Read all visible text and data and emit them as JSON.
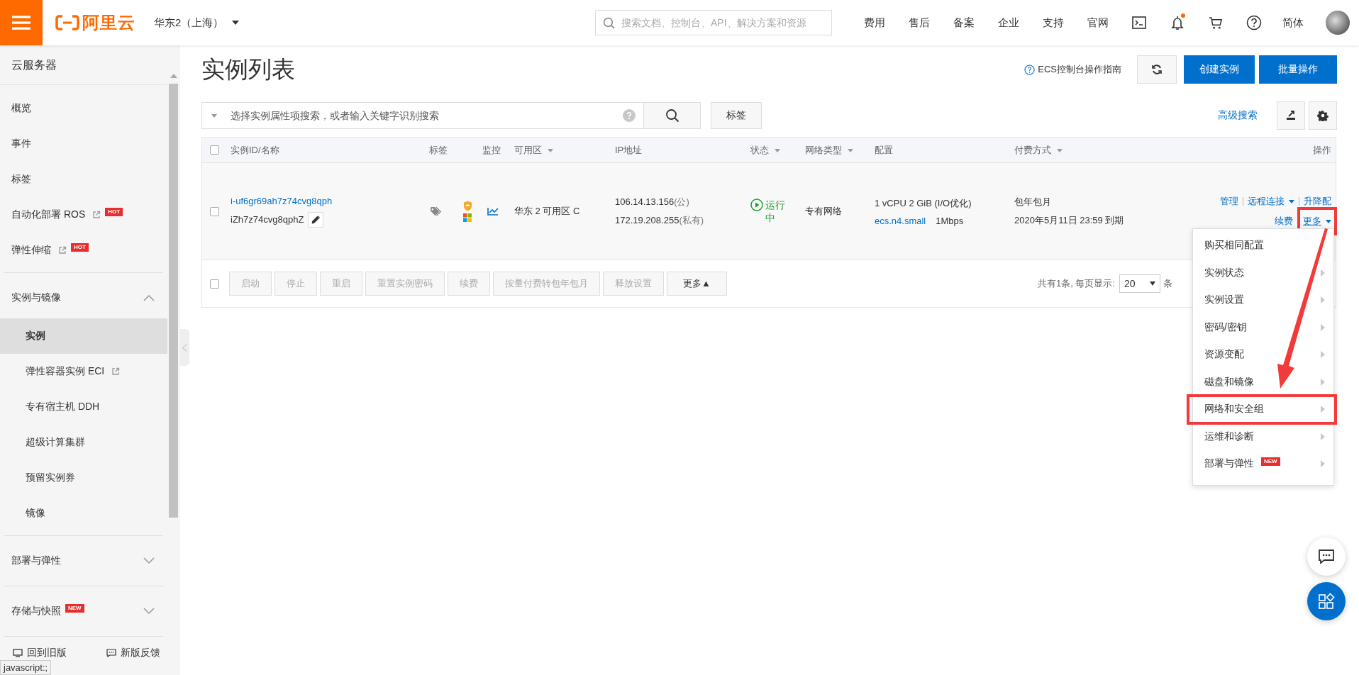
{
  "topbar": {
    "brand": "阿里云",
    "region": "华东2（上海）",
    "search": {
      "placeholder": "搜索文档、控制台、API、解决方案和资源"
    },
    "nav": [
      "费用",
      "售后",
      "备案",
      "企业",
      "支持",
      "官网"
    ],
    "notification_dot": true,
    "language": "简体"
  },
  "sidebar": {
    "title": "云服务器",
    "items": [
      {
        "label": "概览",
        "external": false
      },
      {
        "label": "事件",
        "external": false
      },
      {
        "label": "标签",
        "external": false
      },
      {
        "label": "自动化部署 ROS",
        "external": true,
        "badge": "HOT"
      },
      {
        "label": "弹性伸缩",
        "external": true,
        "badge": "HOT"
      }
    ],
    "groups": [
      {
        "label": "实例与镜像",
        "expanded": true,
        "children": [
          {
            "label": "实例",
            "selected": true,
            "external": false
          },
          {
            "label": "弹性容器实例 ECI",
            "selected": false,
            "external": true
          },
          {
            "label": "专有宿主机 DDH",
            "selected": false,
            "external": false
          },
          {
            "label": "超级计算集群",
            "selected": false,
            "external": false
          },
          {
            "label": "预留实例券",
            "selected": false,
            "external": false
          },
          {
            "label": "镜像",
            "selected": false,
            "external": false
          }
        ]
      },
      {
        "label": "部署与弹性",
        "expanded": false
      },
      {
        "label": "存储与快照",
        "expanded": false,
        "badge": "NEW"
      }
    ],
    "footer": [
      "回到旧版",
      "新版反馈"
    ]
  },
  "page": {
    "title": "实例列表",
    "guide_link": "ECS控制台操作指南",
    "buttons": [
      "创建实例",
      "批量操作"
    ]
  },
  "search": {
    "placeholder": "选择实例属性项搜索，或者输入关键字识别搜索",
    "tag_button": "标签",
    "advanced": "高级搜索"
  },
  "table": {
    "all_checked": false,
    "columns": [
      {
        "label": "实例ID/名称",
        "filter": false
      },
      {
        "label": "标签",
        "filter": false
      },
      {
        "label": "监控",
        "filter": false
      },
      {
        "label": "可用区",
        "filter": true
      },
      {
        "label": "IP地址",
        "filter": false
      },
      {
        "label": "状态",
        "filter": true
      },
      {
        "label": "网络类型",
        "filter": true
      },
      {
        "label": "配置",
        "filter": false
      },
      {
        "label": "付费方式",
        "filter": true
      },
      {
        "label": "操作",
        "filter": false
      }
    ],
    "rows": [
      {
        "checked": false,
        "id": "i-uf6gr69ah7z74cvg8qph",
        "name": "iZh7z74cvg8qphZ",
        "zone": "华东 2 可用区 C",
        "public_ip": "106.14.13.156",
        "public_suffix": "(公)",
        "private_ip": "172.19.208.255",
        "private_suffix": "(私有)",
        "status": "运行中",
        "running": true,
        "network": "专有网络",
        "spec": "1 vCPU 2 GiB (I/O优化)",
        "instance_type": "ecs.n4.small",
        "bandwidth": "1Mbps",
        "billing": "包年包月",
        "expiry": "2020年5月11日 23:59 到期",
        "action_lines": [
          {
            "separated": true,
            "items": [
              {
                "label": "管理",
                "dropdown": false,
                "annotated": false
              },
              {
                "label": "远程连接",
                "dropdown": true,
                "annotated": false
              },
              {
                "label": "升降配",
                "dropdown": false,
                "annotated": false
              }
            ]
          },
          {
            "separated": false,
            "items": [
              {
                "label": "续费",
                "dropdown": false,
                "annotated": false
              },
              {
                "label": "更多",
                "dropdown": true,
                "annotated": true
              }
            ]
          }
        ]
      }
    ],
    "footer": {
      "checked": false,
      "buttons": [
        {
          "label": "启动",
          "disabled": true
        },
        {
          "label": "停止",
          "disabled": true
        },
        {
          "label": "重启",
          "disabled": true
        },
        {
          "label": "重置实例密码",
          "disabled": true
        },
        {
          "label": "续费",
          "disabled": true
        },
        {
          "label": "按量付费转包年包月",
          "disabled": true
        },
        {
          "label": "释放设置",
          "disabled": true
        },
        {
          "label": "更多▲",
          "disabled": false
        }
      ],
      "total": "共有1条, 每页显示:",
      "page_size": "20",
      "unit": "条"
    }
  },
  "more_menu": {
    "items": [
      {
        "label": "购买相同配置",
        "submenu": false,
        "annotated": false
      },
      {
        "label": "实例状态",
        "submenu": true,
        "annotated": false
      },
      {
        "label": "实例设置",
        "submenu": true,
        "annotated": false
      },
      {
        "label": "密码/密钥",
        "submenu": true,
        "annotated": false
      },
      {
        "label": "资源变配",
        "submenu": true,
        "annotated": false
      },
      {
        "label": "磁盘和镜像",
        "submenu": true,
        "annotated": false
      },
      {
        "label": "网络和安全组",
        "submenu": true,
        "annotated": true
      },
      {
        "label": "运维和诊断",
        "submenu": true,
        "annotated": false
      },
      {
        "label": "部署与弹性",
        "submenu": true,
        "annotated": false,
        "badge": "NEW"
      }
    ]
  },
  "status_tooltip": "javascript:;"
}
